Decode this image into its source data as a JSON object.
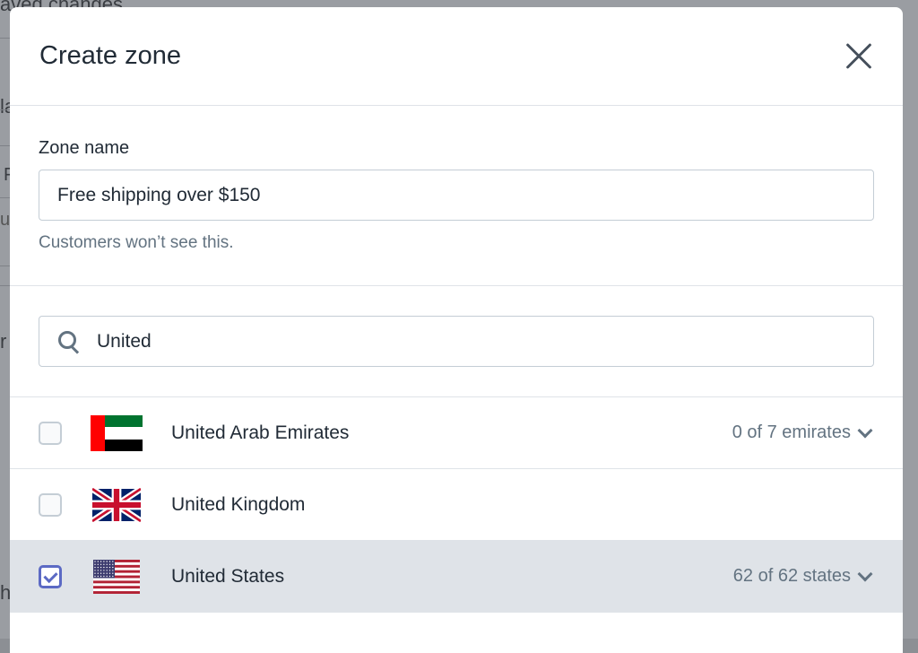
{
  "background": {
    "header_fragment": "aved changes",
    "fragments": [
      "la",
      "F",
      "u",
      "r",
      "h"
    ]
  },
  "modal": {
    "title": "Create zone",
    "zone_name": {
      "label": "Zone name",
      "value": "Free shipping over $150",
      "help": "Customers won’t see this."
    },
    "search": {
      "value": "United"
    },
    "countries": [
      {
        "name": "United Arab Emirates",
        "checked": false,
        "count": "0 of 7 emirates",
        "flag": "uae-flag"
      },
      {
        "name": "United Kingdom",
        "checked": false,
        "count": "",
        "flag": "uk-flag"
      },
      {
        "name": "United States",
        "checked": true,
        "count": "62 of 62 states",
        "flag": "us-flag"
      }
    ]
  },
  "colors": {
    "accent": "#5c6ac4",
    "text": "#212b36",
    "muted": "#637381",
    "border": "#dfe3e8",
    "selected_row": "#dfe3e8"
  }
}
